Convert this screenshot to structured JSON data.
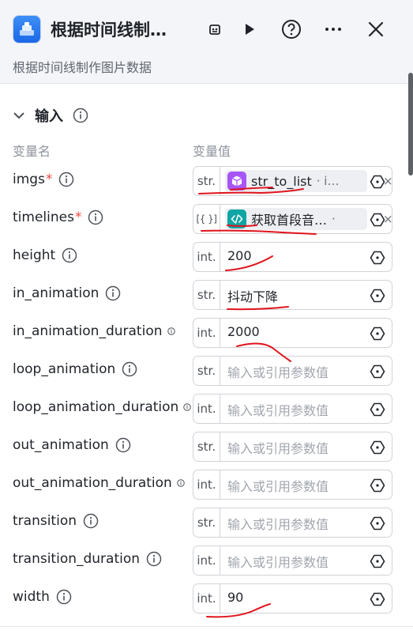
{
  "header": {
    "title": "根据时间线制…",
    "subtitle": "根据时间线制作图片数据"
  },
  "section": {
    "title": "输入",
    "col_name": "变量名",
    "col_value": "变量值"
  },
  "rows": [
    {
      "label": "imgs",
      "required": true,
      "type": "str.",
      "ref": {
        "name": "str_to_list",
        "suffix": "· i…",
        "icon": "cube-icon",
        "color": "#a855f7"
      }
    },
    {
      "label": "timelines",
      "required": true,
      "type": "[{ }]",
      "ref": {
        "name": "获取首段音…",
        "suffix": "·",
        "icon": "code-icon",
        "color": "#0ea5a4"
      }
    },
    {
      "label": "height",
      "type": "int.",
      "value": "200"
    },
    {
      "label": "in_animation",
      "type": "str.",
      "value": "抖动下降"
    },
    {
      "label": "in_animation_duration",
      "type": "int.",
      "value": "2000"
    },
    {
      "label": "loop_animation",
      "type": "str.",
      "placeholder": "输入或引用参数值"
    },
    {
      "label": "loop_animation_duration",
      "type": "int.",
      "placeholder": "输入或引用参数值"
    },
    {
      "label": "out_animation",
      "type": "str.",
      "placeholder": "输入或引用参数值"
    },
    {
      "label": "out_animation_duration",
      "type": "int.",
      "placeholder": "输入或引用参数值"
    },
    {
      "label": "transition",
      "type": "str.",
      "placeholder": "输入或引用参数值"
    },
    {
      "label": "transition_duration",
      "type": "int.",
      "placeholder": "输入或引用参数值"
    },
    {
      "label": "width",
      "type": "int.",
      "value": "90"
    }
  ],
  "colors": {
    "accent_blue": "#1d67e6",
    "required": "#f54a45",
    "annotation_red": "#e0141c"
  }
}
